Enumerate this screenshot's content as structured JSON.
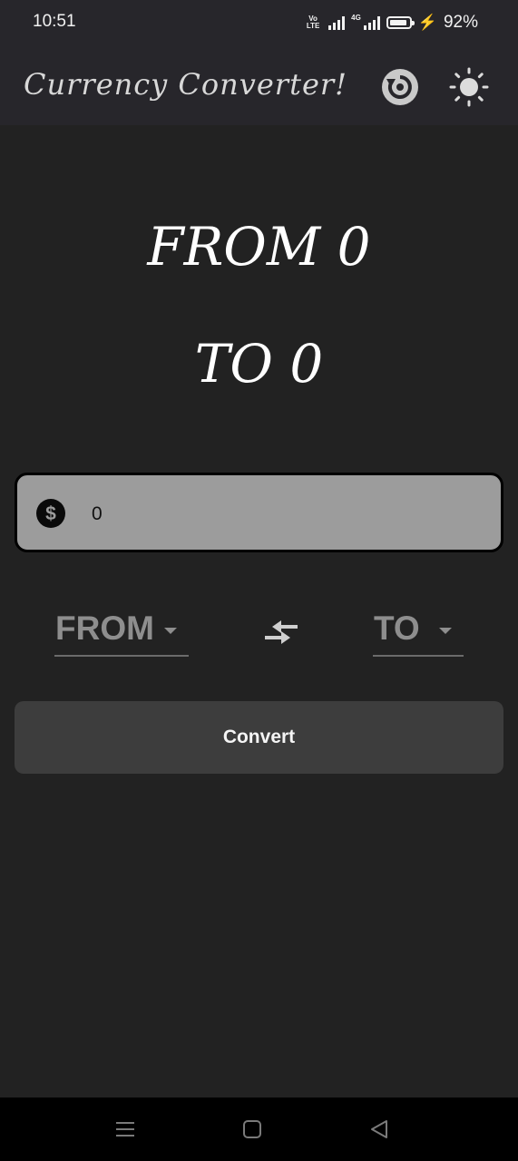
{
  "status_bar": {
    "time": "10:51",
    "volte_line1": "Vo",
    "volte_line2": "LTE",
    "network_type": "4G",
    "battery_percent": "92%",
    "battery_level": 0.92
  },
  "app_bar": {
    "title": "Currency Converter!",
    "history_icon": "history-icon",
    "theme_icon": "sun-icon"
  },
  "result": {
    "from_text": "FROM 0",
    "to_text": "TO 0"
  },
  "amount_input": {
    "value": "0",
    "icon": "dollar-icon"
  },
  "selectors": {
    "from_label": "FROM",
    "to_label": "TO",
    "swap_icon": "swap-arrows-icon"
  },
  "convert_button": {
    "label": "Convert"
  },
  "nav_bar": {
    "icons": [
      "menu-icon",
      "home-icon",
      "back-icon"
    ]
  },
  "colors": {
    "background": "#222222",
    "app_bar": "#27262b",
    "input_background": "#9c9c9c",
    "button_background": "#3d3d3d",
    "dropdown_text": "#8e8e8e"
  }
}
